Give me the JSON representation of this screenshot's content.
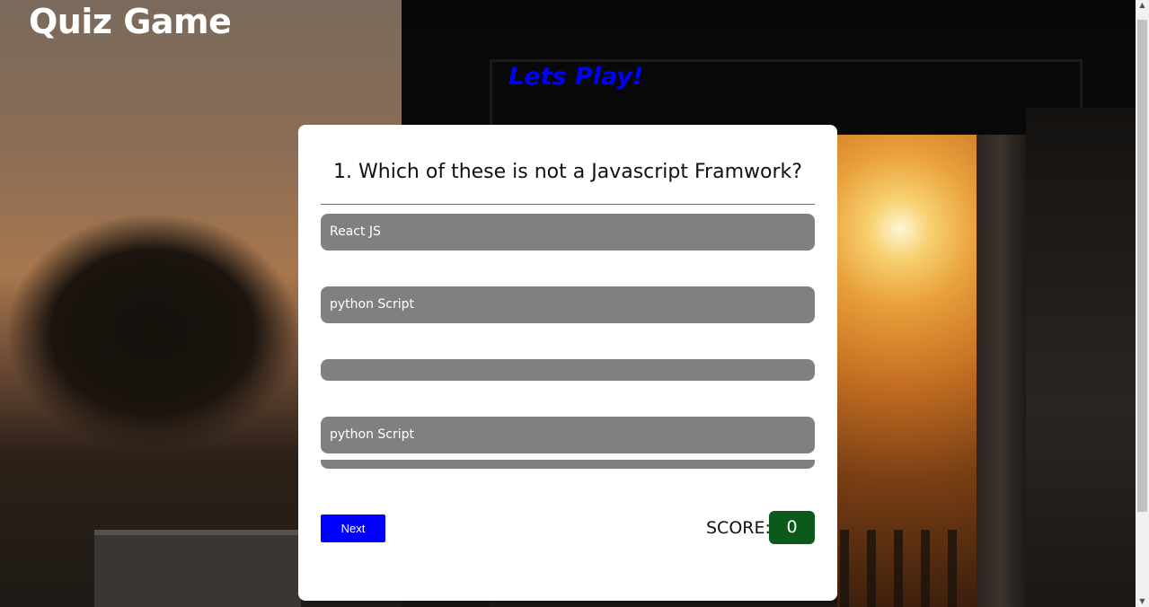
{
  "header": {
    "title": "Quiz Game",
    "subtitle": "Lets Play!"
  },
  "quiz": {
    "question": "1. Which of these is not a Javascript Framwork?",
    "options": [
      "React JS",
      "python Script",
      "",
      "python Script",
      ""
    ],
    "next_label": "Next",
    "score_label": "SCORE:",
    "score_value": "0"
  },
  "colors": {
    "accent_blue": "#0000ff",
    "option_gray": "#808080",
    "score_green": "#0b5a1a",
    "card_bg": "#ffffff"
  },
  "icons": {
    "scroll_up": "scroll-up-arrow-icon",
    "scroll_down": "scroll-down-arrow-icon"
  }
}
